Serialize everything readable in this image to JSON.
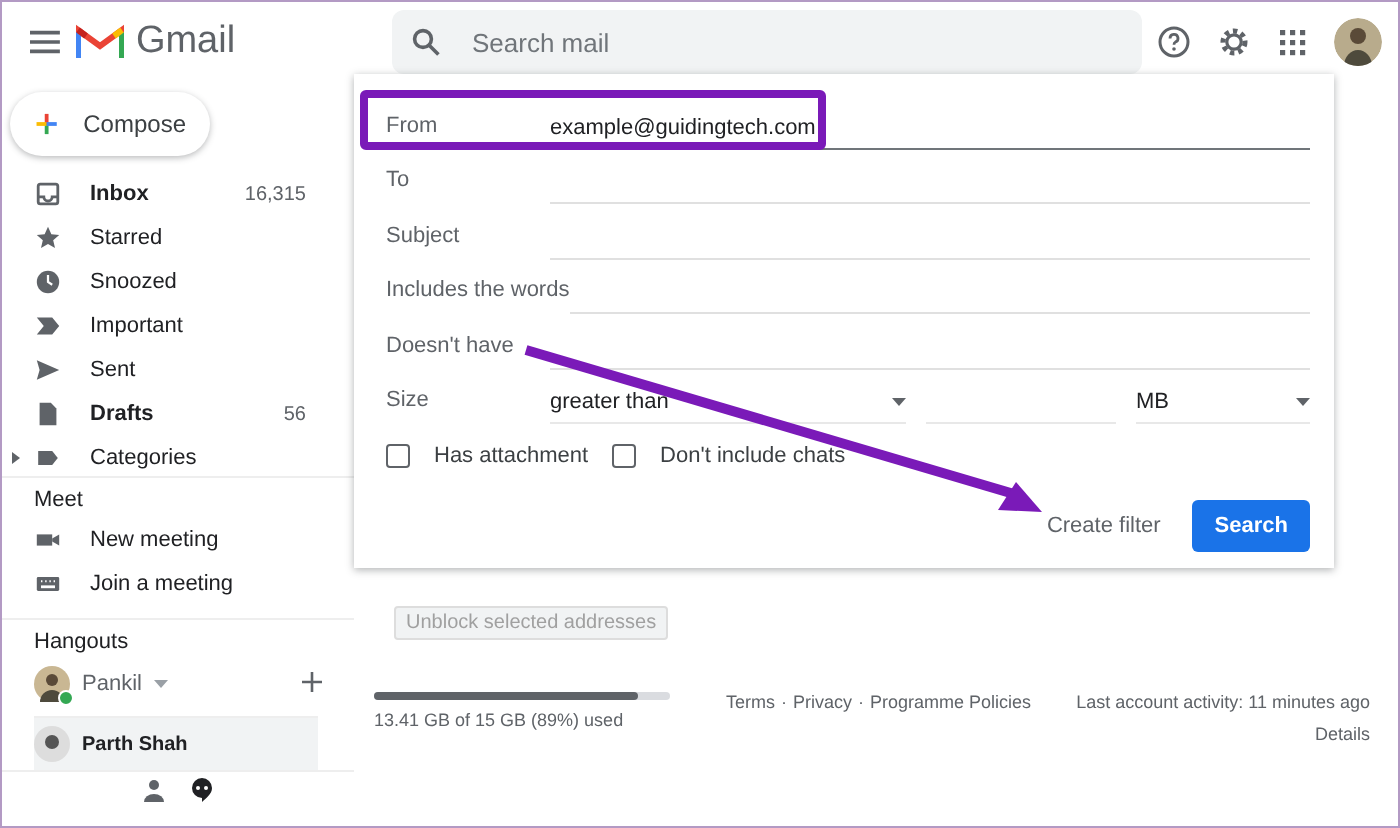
{
  "header": {
    "app_name": "Gmail",
    "search": {
      "placeholder": "Search mail"
    }
  },
  "sidebar": {
    "compose": "Compose",
    "items": [
      {
        "kind": "inbox",
        "label": "Inbox",
        "count": "16,315",
        "unread": true
      },
      {
        "kind": "star",
        "label": "Starred",
        "unread": false
      },
      {
        "kind": "clock",
        "label": "Snoozed",
        "unread": false
      },
      {
        "kind": "important",
        "label": "Important",
        "unread": false
      },
      {
        "kind": "send",
        "label": "Sent",
        "unread": false
      },
      {
        "kind": "draft",
        "label": "Drafts",
        "count": "56",
        "unread": true
      },
      {
        "kind": "label",
        "label": "Categories",
        "unread": false,
        "expanded": false
      }
    ],
    "meet": {
      "title": "Meet",
      "items": [
        {
          "kind": "video",
          "label": "New meeting"
        },
        {
          "kind": "keyboard",
          "label": "Join a meeting"
        }
      ]
    },
    "hangouts": {
      "title": "Hangouts",
      "user": {
        "name": "Pankil",
        "online": true
      },
      "contacts": [
        {
          "name": "Parth Shah"
        }
      ]
    }
  },
  "search_panel": {
    "fields": [
      {
        "kind": "text",
        "label": "From",
        "value": "example@guidingtech.com",
        "focused": true
      },
      {
        "kind": "text",
        "label": "To",
        "focused": false
      },
      {
        "kind": "text",
        "label": "Subject",
        "focused": false
      },
      {
        "kind": "text",
        "label": "Includes the words",
        "focused": false
      },
      {
        "kind": "text",
        "label": "Doesn't have",
        "focused": false
      },
      {
        "kind": "size",
        "label": "Size",
        "operator": "greater than",
        "unit": "MB"
      }
    ],
    "checkboxes": [
      {
        "label": "Has attachment",
        "checked": false
      },
      {
        "label": "Don't include chats",
        "checked": false
      }
    ],
    "buttons": [
      {
        "kind": "text",
        "label": "Create filter"
      },
      {
        "kind": "primary",
        "label": "Search"
      }
    ]
  },
  "main": {
    "unblock_button": {
      "label": "Unblock selected addresses",
      "disabled": true
    },
    "storage": {
      "level": 0.89,
      "text": "13.41 GB of 15 GB (89%) used"
    },
    "footer_links": [
      "Terms",
      "Privacy",
      "Programme Policies"
    ],
    "footer_separator": "·",
    "activity": "Last account activity: 11 minutes ago",
    "details": "Details"
  }
}
